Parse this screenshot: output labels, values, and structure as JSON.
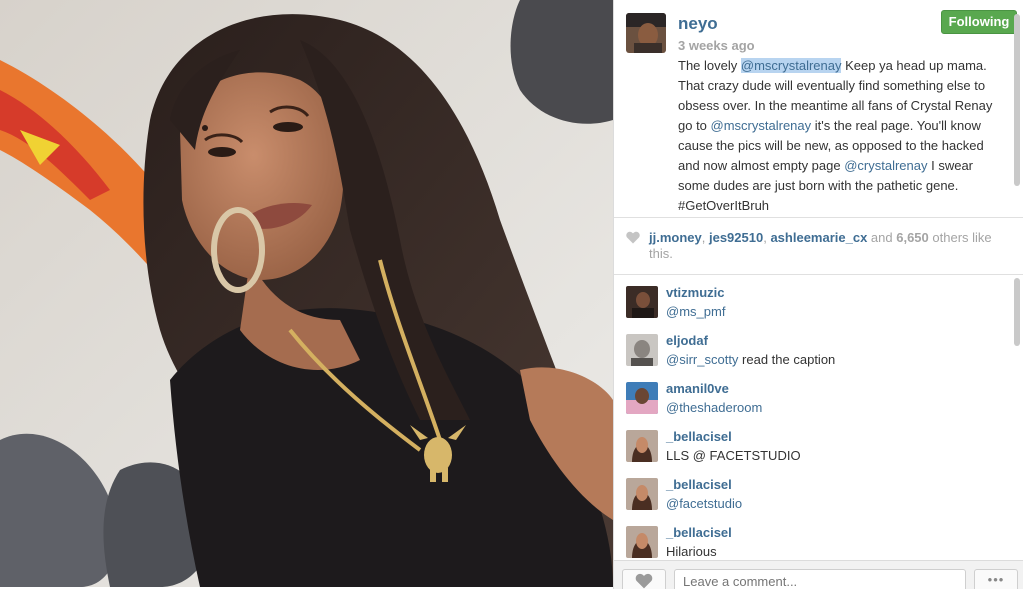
{
  "post": {
    "owner": "neyo",
    "follow_label": "Following",
    "time": "3 weeks ago",
    "caption": {
      "p1": "The lovely ",
      "m1": "@mscrystalrenay",
      "p2": " Keep ya head up mama. That crazy dude will eventually find something else to obsess over. In the meantime all fans of Crystal Renay go to ",
      "m2": "@mscrystalrenay",
      "p3": " it's the real page. You'll know cause the pics will be new, as opposed to the hacked and now almost empty page ",
      "m3": "@crystalrenay",
      "p4": " I swear some dudes are just born with the pathetic gene. #GetOverItBruh"
    }
  },
  "likes": {
    "users": [
      "jj.money",
      "jes92510",
      "ashleemarie_cx"
    ],
    "sep1": ", ",
    "sep2": ", ",
    "and_text": " and ",
    "count": "6,650",
    "suffix": " others like this."
  },
  "comments": [
    {
      "user": "vtizmuzic",
      "mention": "@ms_pmf",
      "text": ""
    },
    {
      "user": "eljodaf",
      "mention": "@sirr_scotty",
      "text": " read the caption"
    },
    {
      "user": "amanil0ve",
      "mention": "@theshaderoom",
      "text": ""
    },
    {
      "user": "_bellacisel",
      "mention": "",
      "text": "LLS @ FACETSTUDIO"
    },
    {
      "user": "_bellacisel",
      "mention": "@facetstudio",
      "text": ""
    },
    {
      "user": "_bellacisel",
      "mention": "",
      "text": "Hilarious"
    }
  ],
  "footer": {
    "comment_placeholder": "Leave a comment...",
    "more_label": "•••"
  },
  "icons": {
    "heart": "heart-icon",
    "more": "more-icon"
  },
  "colors": {
    "link": "#3f6d93",
    "following_button": "#59a84f",
    "mention_highlight": "#b8d4f0"
  }
}
